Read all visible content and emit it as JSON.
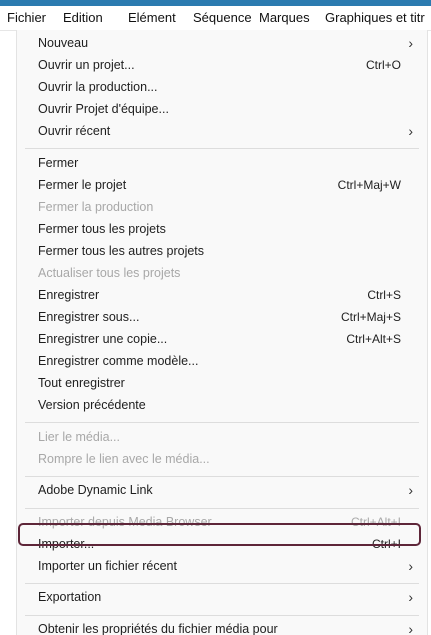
{
  "menubar": {
    "items": [
      "Fichier",
      "Edition",
      "Elément",
      "Séquence",
      "Marques",
      "Graphiques et titr"
    ]
  },
  "menu": {
    "items": [
      {
        "label": "Nouveau",
        "shortcut": "",
        "submenu": true,
        "enabled": true
      },
      {
        "label": "Ouvrir un projet...",
        "shortcut": "Ctrl+O",
        "submenu": false,
        "enabled": true
      },
      {
        "label": "Ouvrir la production...",
        "shortcut": "",
        "submenu": false,
        "enabled": true
      },
      {
        "label": "Ouvrir Projet d'équipe...",
        "shortcut": "",
        "submenu": false,
        "enabled": true
      },
      {
        "label": "Ouvrir récent",
        "shortcut": "",
        "submenu": true,
        "enabled": true
      },
      {
        "label": "Fermer",
        "shortcut": "",
        "submenu": false,
        "enabled": true
      },
      {
        "label": "Fermer le projet",
        "shortcut": "Ctrl+Maj+W",
        "submenu": false,
        "enabled": true
      },
      {
        "label": "Fermer la production",
        "shortcut": "",
        "submenu": false,
        "enabled": false
      },
      {
        "label": "Fermer tous les projets",
        "shortcut": "",
        "submenu": false,
        "enabled": true
      },
      {
        "label": "Fermer tous les autres projets",
        "shortcut": "",
        "submenu": false,
        "enabled": true
      },
      {
        "label": "Actualiser tous les projets",
        "shortcut": "",
        "submenu": false,
        "enabled": false
      },
      {
        "label": "Enregistrer",
        "shortcut": "Ctrl+S",
        "submenu": false,
        "enabled": true
      },
      {
        "label": "Enregistrer sous...",
        "shortcut": "Ctrl+Maj+S",
        "submenu": false,
        "enabled": true
      },
      {
        "label": "Enregistrer une copie...",
        "shortcut": "Ctrl+Alt+S",
        "submenu": false,
        "enabled": true
      },
      {
        "label": "Enregistrer comme modèle...",
        "shortcut": "",
        "submenu": false,
        "enabled": true
      },
      {
        "label": "Tout enregistrer",
        "shortcut": "",
        "submenu": false,
        "enabled": true
      },
      {
        "label": "Version précédente",
        "shortcut": "",
        "submenu": false,
        "enabled": true
      },
      {
        "label": "Lier le média...",
        "shortcut": "",
        "submenu": false,
        "enabled": false
      },
      {
        "label": "Rompre le lien avec le média...",
        "shortcut": "",
        "submenu": false,
        "enabled": false
      },
      {
        "label": "Adobe Dynamic Link",
        "shortcut": "",
        "submenu": true,
        "enabled": true
      },
      {
        "label": "Importer depuis Media Browser",
        "shortcut": "Ctrl+Alt+I",
        "submenu": false,
        "enabled": false
      },
      {
        "label": "Importer...",
        "shortcut": "Ctrl+I",
        "submenu": false,
        "enabled": true,
        "highlighted": true
      },
      {
        "label": "Importer un fichier récent",
        "shortcut": "",
        "submenu": true,
        "enabled": true
      },
      {
        "label": "Exportation",
        "shortcut": "",
        "submenu": true,
        "enabled": true
      },
      {
        "label": "Obtenir les propriétés du fichier média pour",
        "shortcut": "",
        "submenu": true,
        "enabled": true
      }
    ]
  },
  "icons": {
    "submenu_arrow": "chevron-right-icon",
    "submenu_glyph": "›"
  },
  "colors": {
    "menubar_accent": "#2b7bb0",
    "menu_background": "#f9f9f9",
    "text": "#1e1e1e",
    "disabled_text": "#a8a8a8",
    "highlight_border": "#5e2639"
  }
}
